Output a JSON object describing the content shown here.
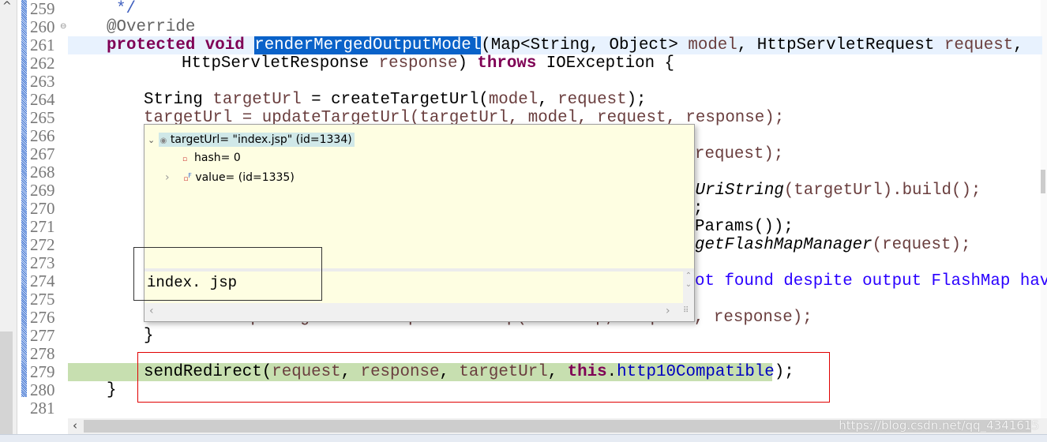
{
  "editor": {
    "line_numbers": [
      "259",
      "260",
      "261",
      "262",
      "263",
      "264",
      "265",
      "266",
      "267",
      "268",
      "269",
      "270",
      "271",
      "272",
      "273",
      "274",
      "275",
      "276",
      "277",
      "278",
      "279",
      "280",
      "281"
    ],
    "lines": {
      "l259": "*/",
      "l260": "@Override",
      "l261_kw": "protected void",
      "l261_method": "renderMergedOutputModel",
      "l261_a": "(Map<String, Object> ",
      "l261_model": "model",
      "l261_b": ", HttpServletRequest ",
      "l261_request": "request",
      "l261_c": ",",
      "l262_a": "HttpServletResponse ",
      "l262_response": "response",
      "l262_b": ") ",
      "l262_throws": "throws",
      "l262_c": " IOException {",
      "l264_a": "String ",
      "l264_var": "targetUrl",
      "l264_b": " = createTargetUrl(",
      "l264_model": "model",
      "l264_c": ", ",
      "l264_request": "request",
      "l264_d": ");",
      "l265": "targetUrl = updateTargetUrl(targetUrl, model, request, response);",
      "l267": "request);",
      "l269_it": "mUriString",
      "l269_b": "(targetUrl).build();",
      "l270": ";",
      "l271": "Params());",
      "l272_it": "getFlashMapManager",
      "l272_b": "(request);",
      "l274": "ot found despite output FlashMap hav",
      "l276": "flashMapManager.saveOutputFlashMap(flashMap, request, response);",
      "l277": "}",
      "l279_a": "sendRedirect(",
      "l279_request": "request",
      "l279_c1": ", ",
      "l279_response": "response",
      "l279_c2": ", ",
      "l279_target": "targetUrl",
      "l279_c3": ", ",
      "l279_this": "this",
      "l279_dot": ".",
      "l279_field": "http10Compatible",
      "l279_end": ");",
      "l280": "}"
    }
  },
  "popup": {
    "root": "targetUrl= \"index.jsp\" (id=1334)",
    "children": [
      "hash= 0",
      "value= (id=1335)"
    ],
    "detail": "index. jsp"
  },
  "icons": {
    "expand": "chevron-down-icon",
    "collapse": "chevron-right-icon"
  },
  "colors": {
    "keyword": "#7f0055",
    "current_line": "#e8f2fe",
    "execution_line": "#c7dfb0",
    "selection": "#0a62c9",
    "annotation_box": "#e00000"
  },
  "watermark": "https://blog.csdn.net/qq_4341615"
}
